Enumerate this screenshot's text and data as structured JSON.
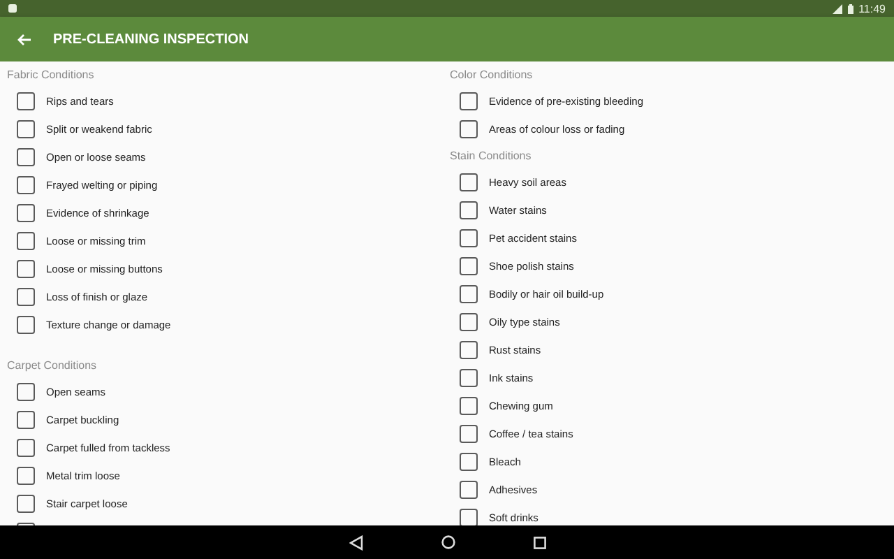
{
  "status_bar": {
    "time": "11:49"
  },
  "app_bar": {
    "title": "PRE-CLEANING INSPECTION"
  },
  "columns": [
    {
      "sections": [
        {
          "title": "Fabric Conditions",
          "items": [
            {
              "label": "Rips and tears",
              "checked": false
            },
            {
              "label": "Split or weakend fabric",
              "checked": false
            },
            {
              "label": "Open or loose seams",
              "checked": false
            },
            {
              "label": "Frayed welting or piping",
              "checked": false
            },
            {
              "label": "Evidence of shrinkage",
              "checked": false
            },
            {
              "label": "Loose or missing trim",
              "checked": false
            },
            {
              "label": "Loose or missing buttons",
              "checked": false
            },
            {
              "label": "Loss of finish or glaze",
              "checked": false
            },
            {
              "label": "Texture change or damage",
              "checked": false
            }
          ]
        },
        {
          "title": "Carpet Conditions",
          "items": [
            {
              "label": "Open seams",
              "checked": false
            },
            {
              "label": "Carpet buckling",
              "checked": false
            },
            {
              "label": "Carpet fulled from tackless",
              "checked": false
            },
            {
              "label": "Metal trim loose",
              "checked": false
            },
            {
              "label": "Stair carpet loose",
              "checked": false
            },
            {
              "checked": false
            }
          ]
        }
      ]
    },
    {
      "sections": [
        {
          "title": "Color Conditions",
          "items": [
            {
              "label": "Evidence of pre-existing bleeding",
              "checked": false
            },
            {
              "label": "Areas of colour loss or fading",
              "checked": false
            }
          ]
        },
        {
          "title": "Stain Conditions",
          "items": [
            {
              "label": "Heavy soil areas",
              "checked": false
            },
            {
              "label": "Water stains",
              "checked": false
            },
            {
              "label": "Pet accident stains",
              "checked": false
            },
            {
              "label": "Shoe polish stains",
              "checked": false
            },
            {
              "label": "Bodily or hair oil build-up",
              "checked": false
            },
            {
              "label": "Oily type stains",
              "checked": false
            },
            {
              "label": "Rust stains",
              "checked": false
            },
            {
              "label": "Ink stains",
              "checked": false
            },
            {
              "label": "Chewing gum",
              "checked": false
            },
            {
              "label": "Coffee / tea stains",
              "checked": false
            },
            {
              "label": "Bleach",
              "checked": false
            },
            {
              "label": "Adhesives",
              "checked": false
            },
            {
              "label": "Soft drinks",
              "checked": false
            }
          ]
        }
      ]
    }
  ]
}
